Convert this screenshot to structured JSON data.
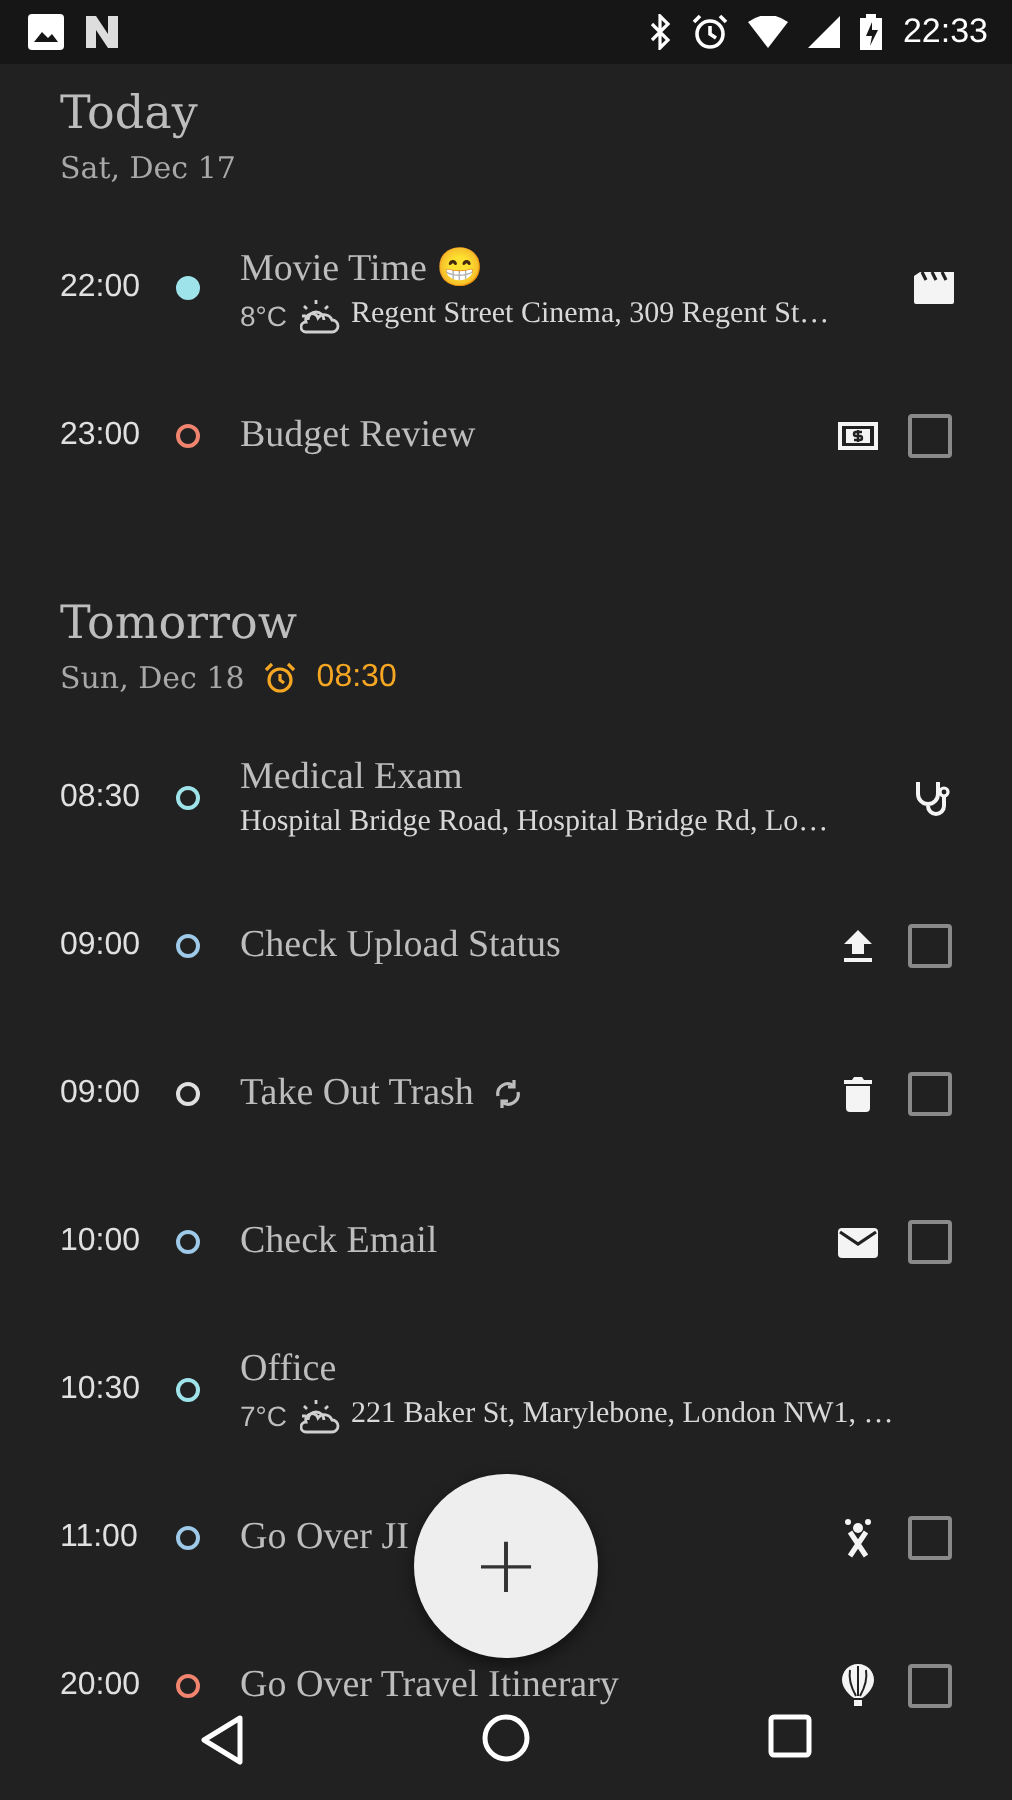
{
  "status_bar": {
    "time": "22:33"
  },
  "sections": [
    {
      "title": "Today",
      "date": "Sat, Dec 17",
      "items": [
        {
          "kind": "event",
          "time": "22:00",
          "color": "#9fe3ea",
          "filled": true,
          "title": "Movie Time 😁",
          "temp": "8°C",
          "location": "Regent Street Cinema, 309 Regent St…"
        },
        {
          "kind": "task",
          "time": "23:00",
          "color": "#f0846e",
          "filled": false,
          "title": "Budget Review",
          "checked": false
        }
      ]
    },
    {
      "title": "Tomorrow",
      "date": "Sun, Dec 18",
      "alarm": "08:30",
      "items": [
        {
          "kind": "event",
          "time": "08:30",
          "color": "#9fe3ea",
          "filled": false,
          "title": "Medical Exam",
          "location": "Hospital Bridge Road, Hospital Bridge Rd, Lo…"
        },
        {
          "kind": "task",
          "time": "09:00",
          "color": "#9ec9e8",
          "filled": false,
          "title": "Check Upload Status",
          "checked": false
        },
        {
          "kind": "task",
          "time": "09:00",
          "color": "#e0e0e0",
          "filled": false,
          "title": "Take Out Trash",
          "repeating": true,
          "checked": false
        },
        {
          "kind": "task",
          "time": "10:00",
          "color": "#9ec9e8",
          "filled": false,
          "title": "Check Email",
          "checked": false
        },
        {
          "kind": "event",
          "time": "10:30",
          "color": "#9fe3ea",
          "filled": false,
          "title": "Office",
          "temp": "7°C",
          "location": "221 Baker St, Marylebone, London NW1, …"
        },
        {
          "kind": "task",
          "time": "11:00",
          "color": "#9ec9e8",
          "filled": false,
          "title": "Go Over JI",
          "checked": false
        },
        {
          "kind": "task",
          "time": "20:00",
          "color": "#f0846e",
          "filled": false,
          "title": "Go Over Travel Itinerary",
          "checked": false
        }
      ]
    }
  ],
  "fab": {
    "label": "+"
  }
}
